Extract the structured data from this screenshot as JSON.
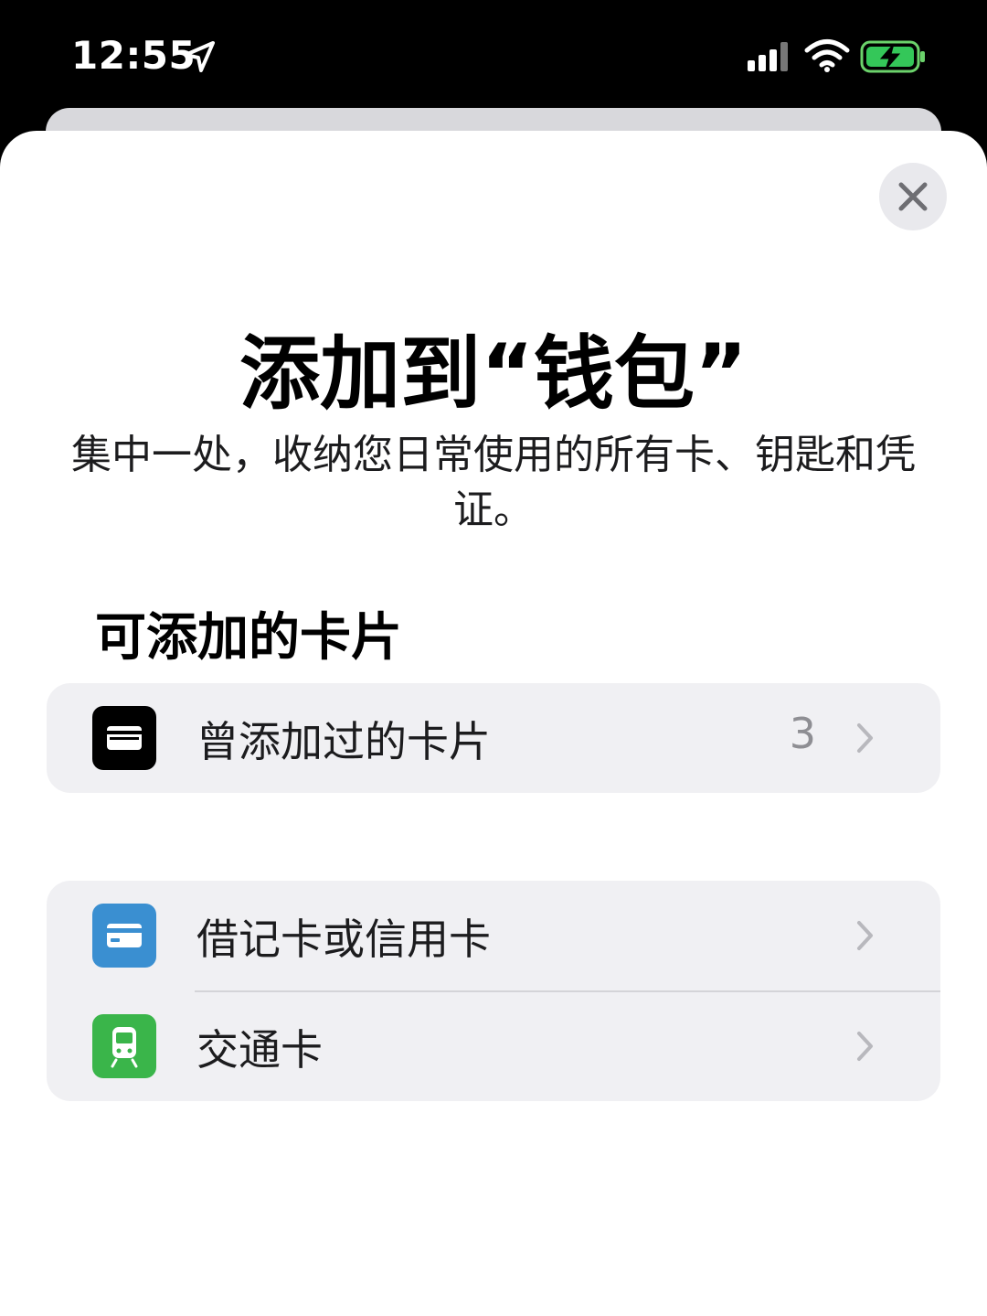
{
  "status_bar": {
    "time": "12:55",
    "icons": [
      "location-arrow-icon",
      "cellular-signal-icon",
      "wifi-icon",
      "battery-charging-icon"
    ]
  },
  "sheet": {
    "title": "添加到“钱包”",
    "subtitle": "集中一处，收纳您日常使用的所有卡、钥匙和凭证。",
    "section_header": "可添加的卡片"
  },
  "groups": {
    "previous": {
      "label": "曾添加过的卡片",
      "count": "3",
      "icon": "wallet-icon",
      "icon_color": "#000000"
    },
    "card_types": [
      {
        "label": "借记卡或信用卡",
        "icon": "credit-card-icon",
        "icon_color": "#3a8fd1"
      },
      {
        "label": "交通卡",
        "icon": "train-icon",
        "icon_color": "#3ab54a"
      }
    ]
  },
  "colors": {
    "sheet_bg": "#ffffff",
    "group_bg": "#f0f0f3",
    "secondary_text": "#8e8e93"
  }
}
